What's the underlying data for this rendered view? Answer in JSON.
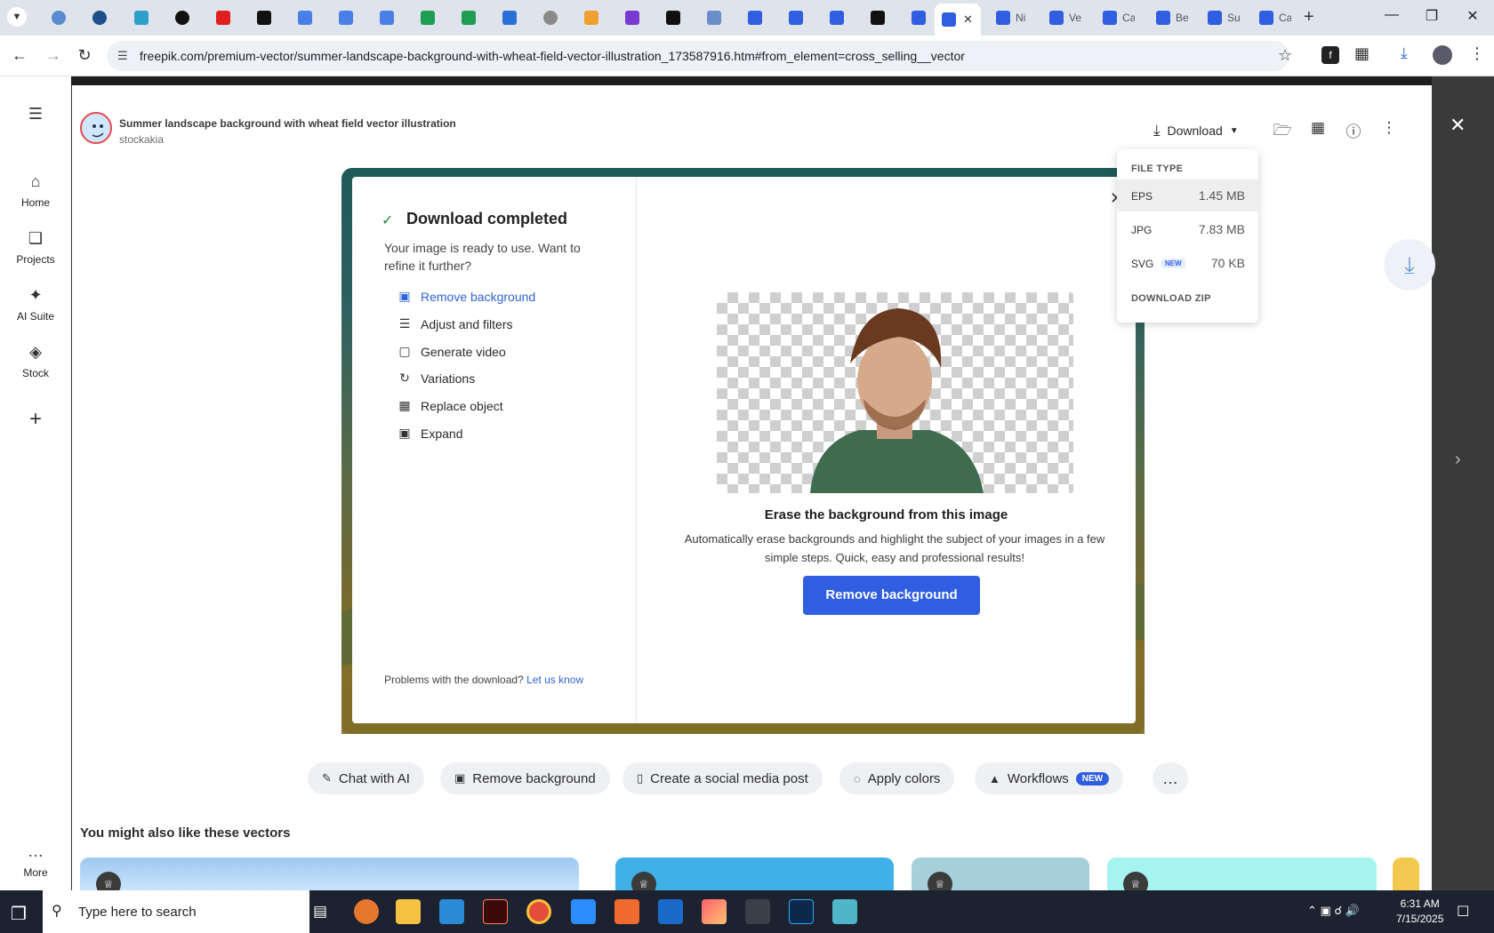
{
  "browser": {
    "address": "freepik.com/premium-vector/summer-landscape-background-with-wheat-field-vector-illustration_173587916.htm#from_element=cross_selling__vector",
    "tabs": [
      {
        "label": "Ni"
      },
      {
        "label": "Ve"
      },
      {
        "label": "Ca"
      },
      {
        "label": "Be"
      },
      {
        "label": "Su"
      },
      {
        "label": "Ca"
      }
    ]
  },
  "sidebar": {
    "items": [
      {
        "label": "Home",
        "icon": "home-icon"
      },
      {
        "label": "Projects",
        "icon": "projects-icon"
      },
      {
        "label": "AI Suite",
        "icon": "sparkle-icon"
      },
      {
        "label": "Stock",
        "icon": "stock-icon"
      }
    ],
    "more_label": "More"
  },
  "asset": {
    "title": "Summer landscape background with wheat field vector illustration",
    "author": "stockakia"
  },
  "toolbar": {
    "download_label": "Download"
  },
  "dropdown": {
    "heading": "FILE TYPE",
    "options": [
      {
        "name": "EPS",
        "size": "1.45 MB"
      },
      {
        "name": "JPG",
        "size": "7.83 MB"
      },
      {
        "name": "SVG",
        "badge": "NEW",
        "size": "70 KB"
      }
    ],
    "zip_label": "DOWNLOAD ZIP"
  },
  "modal": {
    "title": "Download completed",
    "subtitle": "Your image is ready to use. Want to refine it further?",
    "options": [
      {
        "label": "Remove background",
        "icon": "remove-bg-icon"
      },
      {
        "label": "Adjust and filters",
        "icon": "sliders-icon"
      },
      {
        "label": "Generate video",
        "icon": "video-icon"
      },
      {
        "label": "Variations",
        "icon": "refresh-icon"
      },
      {
        "label": "Replace object",
        "icon": "replace-icon"
      },
      {
        "label": "Expand",
        "icon": "expand-icon"
      }
    ],
    "problems_text": "Problems with the download?",
    "problems_link": "Let us know",
    "erase_title": "Erase the background from this image",
    "erase_desc": "Automatically erase backgrounds and highlight the subject of your images in a few simple steps. Quick, easy and professional results!",
    "cta_label": "Remove background"
  },
  "chips": [
    {
      "label": "Chat with AI"
    },
    {
      "label": "Remove background"
    },
    {
      "label": "Create a social media post"
    },
    {
      "label": "Apply colors"
    },
    {
      "label": "Workflows",
      "badge": "NEW"
    }
  ],
  "similar_title": "You might also like these vectors",
  "taskbar": {
    "search_placeholder": "Type here to search",
    "time": "6:31 AM",
    "date": "7/15/2025"
  },
  "colors": {
    "accent": "#2f5fe0",
    "link": "#2f63d6",
    "success": "#1f8a4c"
  }
}
